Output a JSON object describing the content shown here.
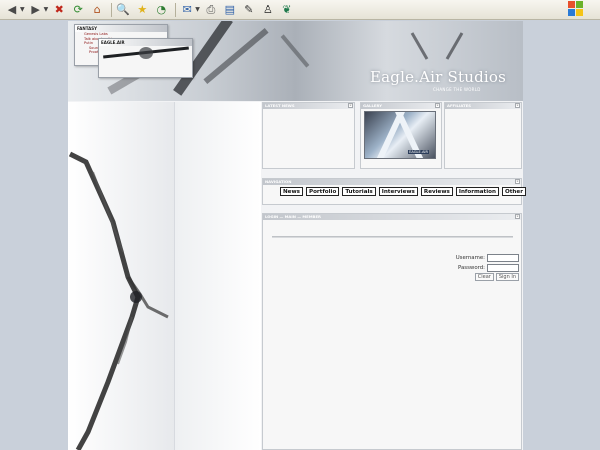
{
  "toolbar": {
    "buttons": [
      {
        "name": "back-icon",
        "glyph": "◀"
      },
      {
        "name": "forward-icon",
        "glyph": "▶"
      },
      {
        "name": "stop-icon",
        "glyph": "✖"
      },
      {
        "name": "refresh-icon",
        "glyph": "⟳"
      },
      {
        "name": "home-icon",
        "glyph": "⌂"
      },
      {
        "name": "search-icon",
        "glyph": "🔍"
      },
      {
        "name": "favorites-icon",
        "glyph": "★"
      },
      {
        "name": "history-icon",
        "glyph": "◔"
      },
      {
        "name": "mail-icon",
        "glyph": "✉"
      },
      {
        "name": "print-icon",
        "glyph": "⎙"
      },
      {
        "name": "edit-icon",
        "glyph": "▤"
      },
      {
        "name": "pen-icon",
        "glyph": "✎"
      },
      {
        "name": "messenger-icon",
        "glyph": "♙"
      },
      {
        "name": "research-icon",
        "glyph": "❦"
      }
    ]
  },
  "header": {
    "brand": "Eagle.Air Studios",
    "tagline": "CHANGE THE WORLD"
  },
  "popups": {
    "back": {
      "title": "FANTASY",
      "lines": [
        "Genesis Labs",
        "Talk about getting",
        "Putin",
        "Sound",
        "Proof"
      ]
    },
    "front": {
      "title": "EAGLE.AIR"
    }
  },
  "panels": {
    "left_title": "LATEST NEWS",
    "middle_title": "GALLERY",
    "right_title": "AFFILIATES",
    "thumb_caption": "EAGLE.AIR",
    "nav_title": "NAVIGATION",
    "login_title": "LOGIN — MAIN — MEMBER"
  },
  "nav": {
    "items": [
      "News",
      "Portfolio",
      "Tutorials",
      "Interviews",
      "Reviews",
      "Information",
      "Other"
    ]
  },
  "login": {
    "username_label": "Username:",
    "password_label": "Password:",
    "clear_label": "Clear",
    "signin_label": "Sign In"
  }
}
